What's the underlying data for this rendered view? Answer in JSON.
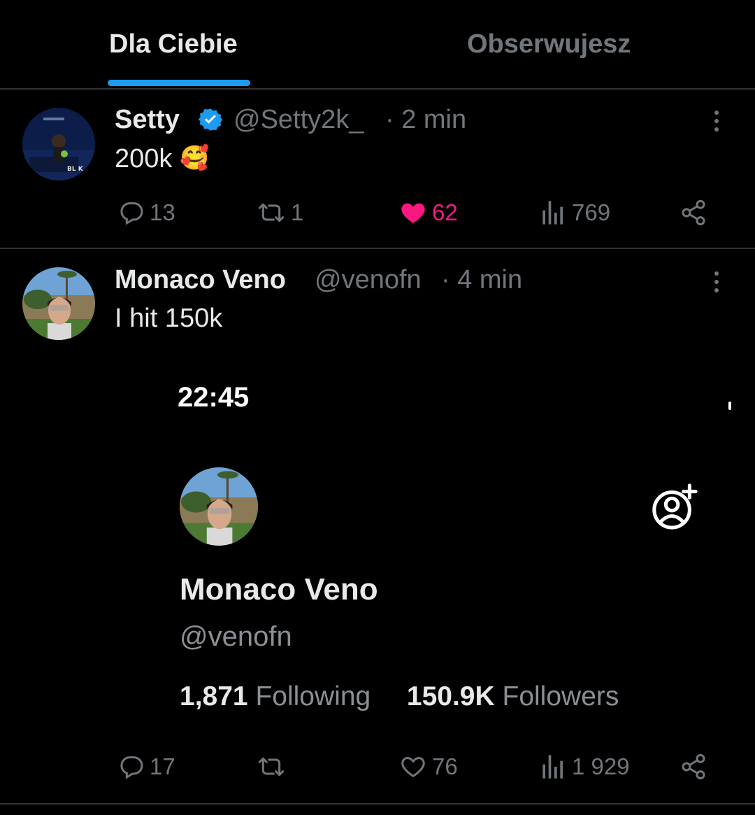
{
  "tabs": [
    {
      "label": "Dla Ciebie",
      "active": true
    },
    {
      "label": "Obserwujesz",
      "active": false
    }
  ],
  "colors": {
    "accent": "#1d9bf0",
    "like": "#f91880",
    "muted": "#71767b",
    "verified": "#1d9bf0"
  },
  "posts": [
    {
      "name": "Setty",
      "verified": true,
      "handle": "@Setty2k_",
      "time": "· 2 min",
      "text": "200k",
      "emoji": "🥰",
      "actions": {
        "replies": "13",
        "reposts": "1",
        "likes": "62",
        "liked": true,
        "views": "769"
      }
    },
    {
      "name": "Monaco Veno",
      "verified": false,
      "handle": "@venofn",
      "time": "· 4 min",
      "text": "I hit 150k",
      "screenshot": {
        "time": "22:45",
        "name": "Monaco Veno",
        "handle": "@venofn",
        "following_count": "1,871",
        "following_label": "Following",
        "followers_count": "150.9K",
        "followers_label": "Followers"
      },
      "actions": {
        "replies": "17",
        "reposts": "",
        "likes": "76",
        "liked": false,
        "views": "1 929"
      }
    }
  ]
}
